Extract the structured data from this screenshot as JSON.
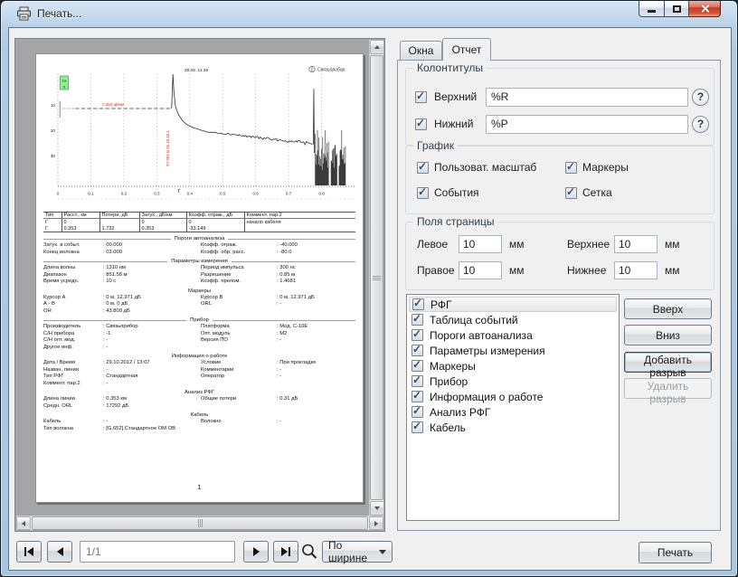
{
  "window": {
    "title": "Печать..."
  },
  "icons": {
    "check": "✓"
  },
  "tabs": [
    {
      "label": "Окна",
      "active": false
    },
    {
      "label": "Отчет",
      "active": true
    }
  ],
  "report_tab": {
    "headers_group": {
      "title": "Колонтитулы",
      "help_label": "?",
      "rows": [
        {
          "label": "Верхний",
          "value": "%R",
          "checked": true
        },
        {
          "label": "Нижний",
          "value": "%P",
          "checked": true
        }
      ]
    },
    "graph_group": {
      "title": "График",
      "options": [
        {
          "label": "Пользоват. масштаб",
          "checked": true
        },
        {
          "label": "Маркеры",
          "checked": true
        },
        {
          "label": "События",
          "checked": true
        },
        {
          "label": "Сетка",
          "checked": true
        }
      ]
    },
    "margins_group": {
      "title": "Поля страницы",
      "unit": "мм",
      "fields": [
        {
          "label": "Левое",
          "value": "10"
        },
        {
          "label": "Верхнее",
          "value": "10"
        },
        {
          "label": "Правое",
          "value": "10"
        },
        {
          "label": "Нижнее",
          "value": "10"
        }
      ]
    },
    "sections_list": {
      "items": [
        {
          "label": "РФГ",
          "checked": true,
          "selected": true
        },
        {
          "label": "Таблица событий",
          "checked": true
        },
        {
          "label": "Пороги автоанализа",
          "checked": true
        },
        {
          "label": "Параметры измерения",
          "checked": true
        },
        {
          "label": "Маркеры",
          "checked": true
        },
        {
          "label": "Прибор",
          "checked": true
        },
        {
          "label": "Информация о работе",
          "checked": true
        },
        {
          "label": "Анализ РФГ",
          "checked": true
        },
        {
          "label": "Кабель",
          "checked": true
        }
      ],
      "buttons": [
        {
          "label": "Вверх",
          "enabled": true
        },
        {
          "label": "Вниз",
          "enabled": true
        },
        {
          "label": "Добавить разрыв",
          "enabled": true,
          "emphasized": true
        },
        {
          "label": "Удалить разрыв",
          "enabled": false
        }
      ]
    }
  },
  "preview_toolbar": {
    "page_indicator": "1/1",
    "zoom_select": "По ширине"
  },
  "print_button_label": "Печать",
  "preview_page": {
    "page_number": "1",
    "chart": {
      "type": "line",
      "title_date": "29.06. 11:45",
      "logo": "Связьприбор",
      "marker_box": [
        "1а",
        "0"
      ],
      "annotation_vertical": "97.953 м  26.10.36.1",
      "annotation_horizontal": "0.353 дБ/км",
      "x_ticks": [
        0,
        0.1,
        0.2,
        0.3,
        0.4,
        0.5,
        0.6,
        0.7,
        0.8
      ],
      "x_range": [
        0,
        0.9
      ],
      "y_ticks": [
        10,
        20,
        30
      ],
      "trace": {
        "baseline_y": 52,
        "front_spike_x": 0.349,
        "decay_points": [
          [
            0.357,
            50
          ],
          [
            0.365,
            58
          ],
          [
            0.377,
            65
          ],
          [
            0.392,
            70
          ],
          [
            0.41,
            73
          ],
          [
            0.435,
            76
          ],
          [
            0.45,
            77.5
          ]
        ],
        "slope_end": [
          0.773,
          91
        ],
        "end_spike_x": 0.7765,
        "noise_range": [
          0.781,
          0.873
        ]
      }
    },
    "events_table": {
      "headers": [
        "Тип",
        "Расст., км",
        "Потери, дБ",
        "Затух., дБ/км",
        "Коэфф. отраж., дБ",
        "Коммент. пар.2"
      ],
      "rows": [
        [
          "Γ",
          "0",
          "",
          "0",
          "0",
          "начало кабеля"
        ],
        [
          "Γ",
          "0.353",
          "1.732",
          "0.353",
          "-33.149",
          ""
        ]
      ]
    },
    "sections": [
      {
        "title": "Пороги автоанализа",
        "rule": true,
        "rows": [
          [
            "Затух. в событ.",
            ": 00.000",
            "Коэфф. отраж.",
            ": -40.000"
          ],
          [
            "Конец волокна",
            ": 03.000",
            "Коэфф. обр. расс.",
            ": -80.0"
          ]
        ]
      },
      {
        "title": "Параметры измерения",
        "rule": true,
        "rows": [
          [
            "Длина волны",
            ": 1310 нм",
            "Период импульса",
            ": 300 нс"
          ],
          [
            "Диапазон",
            ": 851.58 м",
            "Разрешение",
            ": 0.85 м"
          ],
          [
            "Время усредн.",
            ": 10 с",
            "Коэфф. прелом.",
            ": 1.4681"
          ]
        ]
      },
      {
        "title": "Маркеры",
        "rule": false,
        "rows": [
          [
            "Курсор А",
            ": 0 м,  12.971 дБ",
            "Курсор В",
            ": 0 м,  12.971 дБ"
          ],
          [
            "А - В",
            ": 0 м,  0 дБ",
            "ORL",
            ": -"
          ],
          [
            "ОН",
            ": 43.809 дБ",
            "",
            ""
          ]
        ]
      },
      {
        "title": "Прибор",
        "rule": true,
        "rows": [
          [
            "Производитель",
            ": Связьприбор",
            "Платформа",
            ": Мод. С-10Е"
          ],
          [
            "С/Н прибора",
            ": -1",
            "Опт. модуль",
            ": М2"
          ],
          [
            "С/Н опт. мод.",
            ": -",
            "Версия ПО",
            ": -"
          ],
          [
            "Другое инф.",
            ": -",
            "",
            ""
          ]
        ]
      },
      {
        "title": "Информация о работе",
        "rule": false,
        "rows": [
          [
            "Дата / Время",
            ": 29.10.2012 / 13:07",
            "Условие",
            ": При прокладке"
          ],
          [
            "Назван. линии",
            ": -",
            "Комментарии",
            ": -"
          ],
          [
            "Тип РФГ",
            ": Стандартная",
            "Оператор",
            ": -"
          ],
          [
            "Коммент. пар.2",
            ": -",
            "",
            ""
          ]
        ]
      },
      {
        "title": "Анализ РФГ",
        "rule": false,
        "rows": [
          [
            "Длина линии",
            ": 0.353 км",
            "Общие потери",
            ": 0.31 дБ"
          ],
          [
            "Средн. ORL",
            ": 17292 дБ",
            "",
            ""
          ]
        ]
      },
      {
        "title": "Кабель",
        "rule": false,
        "rows": [
          [
            "Кабель",
            ": -",
            "Волокно",
            ": -"
          ],
          [
            "Тип волокна",
            ": [G.652] Стандартное ОМ ОВ",
            "",
            ""
          ]
        ]
      }
    ]
  }
}
